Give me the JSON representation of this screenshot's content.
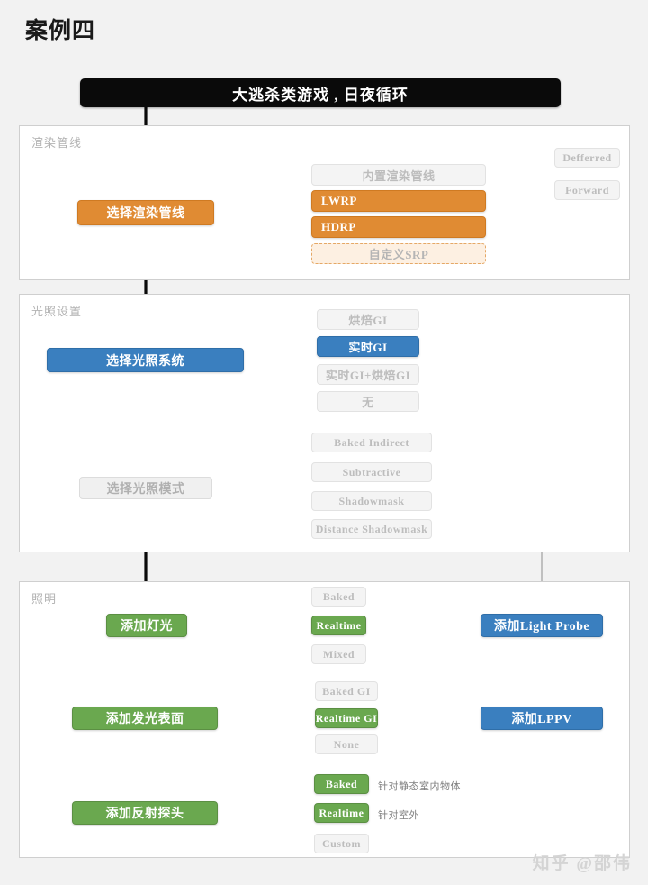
{
  "page": {
    "title": "案例四",
    "watermark": "知乎 @邵伟"
  },
  "flow": {
    "header_label": "大逃杀类游戏 , 日夜循环",
    "sections": [
      {
        "id": "render-pipeline",
        "label": "渲染管线",
        "main_node": "选择渲染管线",
        "branches": [
          {
            "label": "内置渲染管线",
            "state": "inactive"
          },
          {
            "label": "LWRP",
            "state": "active"
          },
          {
            "label": "HDRP",
            "state": "active"
          },
          {
            "label": "自定义SRP",
            "state": "dashed"
          }
        ],
        "sub_branches": [
          {
            "label": "Defferred",
            "state": "inactive"
          },
          {
            "label": "Forward",
            "state": "inactive"
          }
        ]
      },
      {
        "id": "lighting-settings",
        "label": "光照设置",
        "main_node": "选择光照系统",
        "branches": [
          {
            "label": "烘焙GI",
            "state": "inactive"
          },
          {
            "label": "实时GI",
            "state": "active"
          },
          {
            "label": "实时GI+烘焙GI",
            "state": "inactive"
          },
          {
            "label": "无",
            "state": "inactive"
          }
        ],
        "second_node": "选择光照模式",
        "second_branches": [
          {
            "label": "Baked Indirect",
            "state": "inactive"
          },
          {
            "label": "Subtractive",
            "state": "inactive"
          },
          {
            "label": "Shadowmask",
            "state": "inactive"
          },
          {
            "label": "Distance Shadowmask",
            "state": "inactive"
          }
        ]
      },
      {
        "id": "illumination",
        "label": "照明",
        "rows": [
          {
            "main_node": "添加灯光",
            "branches": [
              {
                "label": "Baked",
                "state": "inactive",
                "note": ""
              },
              {
                "label": "Realtime",
                "state": "active",
                "note": ""
              },
              {
                "label": "Mixed",
                "state": "inactive",
                "note": ""
              }
            ]
          },
          {
            "main_node": "添加发光表面",
            "branches": [
              {
                "label": "Baked GI",
                "state": "inactive",
                "note": ""
              },
              {
                "label": "Realtime GI",
                "state": "active",
                "note": ""
              },
              {
                "label": "None",
                "state": "inactive",
                "note": ""
              }
            ]
          },
          {
            "main_node": "添加反射探头",
            "branches": [
              {
                "label": "Baked",
                "state": "active",
                "note": "针对静态室内物体"
              },
              {
                "label": "Realtime",
                "state": "active",
                "note": "针对室外"
              },
              {
                "label": "Custom",
                "state": "inactive",
                "note": ""
              }
            ]
          }
        ],
        "side_nodes": [
          {
            "label": "添加Light Probe"
          },
          {
            "label": "添加LPPV"
          }
        ]
      }
    ]
  },
  "colors": {
    "orange": "#e08b33",
    "blue": "#3a7fbf",
    "green": "#6aa84f",
    "ghost": "#f4f4f4",
    "header": "#0a0a0a"
  }
}
